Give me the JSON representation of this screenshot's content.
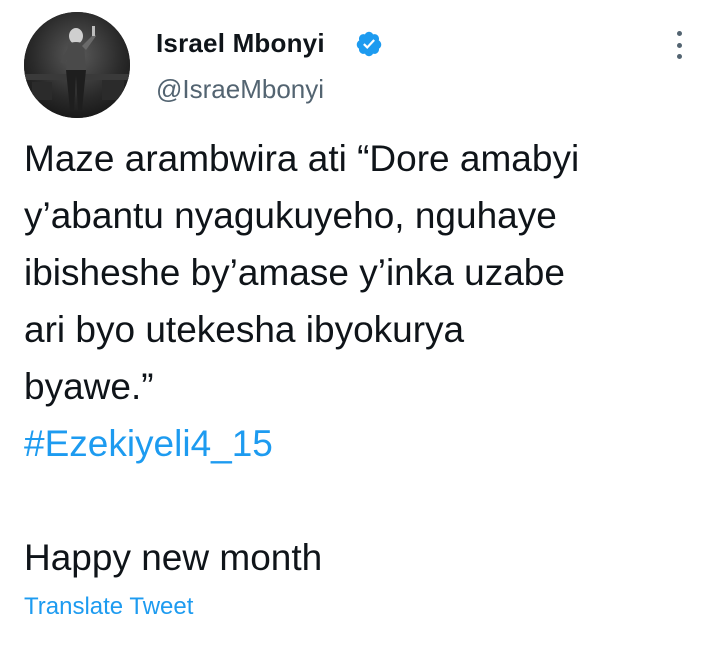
{
  "author": {
    "display_name": "Israel Mbonyi",
    "handle": "@IsraeMbonyi",
    "verified": true,
    "avatar_icon": "profile-photo",
    "verified_icon": "verified-badge-icon",
    "more_icon": "more-options-icon"
  },
  "tweet": {
    "lines": [
      "Maze arambwira ati “Dore amabyi",
      "y’abantu nyagukuyeho, nguhaye",
      "ibisheshe by’amase y’inka uzabe",
      "ari byo utekesha ibyokurya",
      "byawe.”"
    ],
    "hashtag": "#Ezekiyeli4_15",
    "closing": "Happy new month"
  },
  "actions": {
    "translate_label": "Translate Tweet"
  },
  "colors": {
    "link": "#1d9bf0",
    "text": "#0f1419",
    "secondary": "#536471"
  }
}
